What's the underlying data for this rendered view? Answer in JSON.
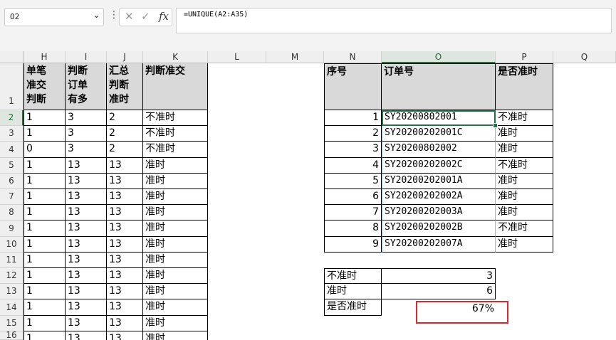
{
  "formula_bar": {
    "name_box": "O2",
    "cancel_icon": "✕",
    "enter_icon": "✓",
    "fx_label": "fx",
    "formula": "=UNIQUE(A2:A35)"
  },
  "columns": [
    "H",
    "I",
    "J",
    "K",
    "L",
    "M",
    "N",
    "O",
    "P",
    "Q"
  ],
  "rows": [
    "1",
    "2",
    "3",
    "4",
    "5",
    "6",
    "7",
    "8",
    "9",
    "10",
    "11",
    "12",
    "13",
    "14",
    "15",
    "16"
  ],
  "left_table": {
    "headers": [
      "单笔\n准交\n判断",
      "判断\n订单\n有多",
      "汇总\n判断\n准时",
      "判断准交"
    ],
    "rows": [
      [
        "1",
        "3",
        "2",
        "不准时"
      ],
      [
        "1",
        "3",
        "2",
        "不准时"
      ],
      [
        "0",
        "3",
        "2",
        "不准时"
      ],
      [
        "1",
        "13",
        "13",
        "准时"
      ],
      [
        "1",
        "13",
        "13",
        "准时"
      ],
      [
        "1",
        "13",
        "13",
        "准时"
      ],
      [
        "1",
        "13",
        "13",
        "准时"
      ],
      [
        "1",
        "13",
        "13",
        "准时"
      ],
      [
        "1",
        "13",
        "13",
        "准时"
      ],
      [
        "1",
        "13",
        "13",
        "准时"
      ],
      [
        "1",
        "13",
        "13",
        "准时"
      ],
      [
        "1",
        "13",
        "13",
        "准时"
      ],
      [
        "1",
        "13",
        "13",
        "准时"
      ],
      [
        "1",
        "13",
        "13",
        "准时"
      ],
      [
        "1",
        "13",
        "13",
        "准时"
      ]
    ]
  },
  "right_table": {
    "headers": [
      "序号",
      "订单号",
      "是否准时"
    ],
    "rows": [
      [
        "1",
        "SY20200802001",
        "不准时"
      ],
      [
        "2",
        "SY20200202001C",
        "准时"
      ],
      [
        "3",
        "SY20200802002",
        "准时"
      ],
      [
        "4",
        "SY20200202002C",
        "不准时"
      ],
      [
        "5",
        "SY20200202001A",
        "准时"
      ],
      [
        "6",
        "SY20200202002A",
        "准时"
      ],
      [
        "7",
        "SY20200202003A",
        "准时"
      ],
      [
        "8",
        "SY20200202002B",
        "不准时"
      ],
      [
        "9",
        "SY20200202007A",
        "准时"
      ]
    ]
  },
  "summary": {
    "rows": [
      [
        "不准时",
        "3"
      ],
      [
        "准时",
        "6"
      ],
      [
        "是否准时",
        "67%"
      ]
    ]
  },
  "colors": {
    "selection": "#217346",
    "highlight_box": "#e0262a",
    "header_fill": "#d9d9d9"
  }
}
